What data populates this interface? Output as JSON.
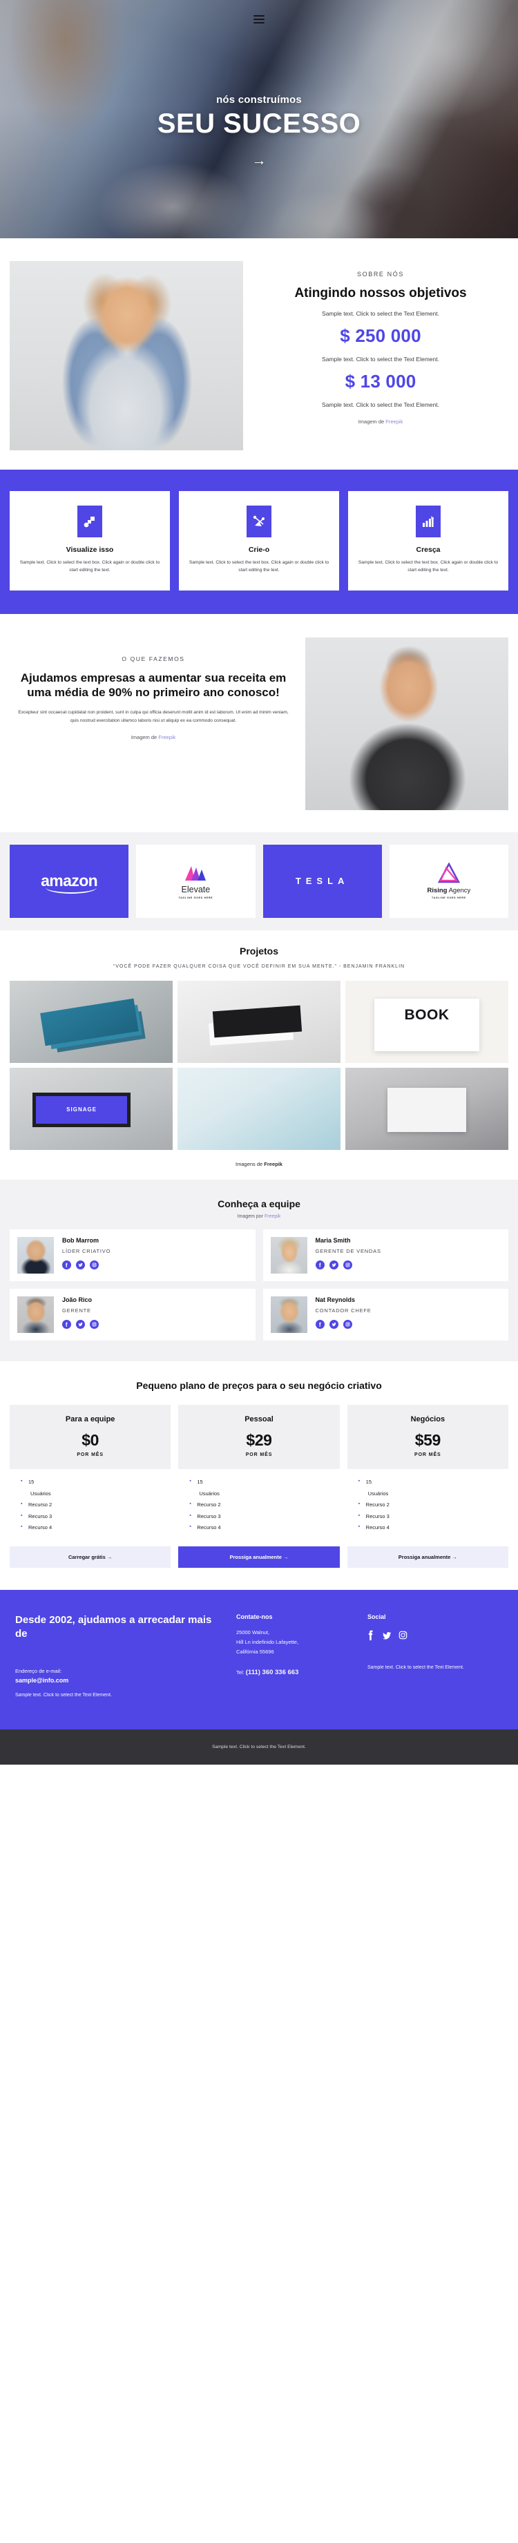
{
  "hero": {
    "menu_icon": "hamburger-menu-icon",
    "eyebrow": "nós construímos",
    "title": "SEU SUCESSO",
    "arrow": "→"
  },
  "about": {
    "eyebrow": "SOBRE NÓS",
    "title": "Atingindo nossos objetivos",
    "desc1": "Sample text. Click to select the Text Element.",
    "stat1": "$ 250 000",
    "desc2": "Sample text. Click to select the Text Element.",
    "stat2": "$ 13 000",
    "desc3": "Sample text. Click to select the Text Element.",
    "credit_prefix": "Imagem de ",
    "credit_link": "Freepik"
  },
  "features": {
    "cards": [
      {
        "icon": "shapes-icon",
        "title": "Visualize isso",
        "body": "Sample text. Click to select the text box. Click again or double click to start editing the text."
      },
      {
        "icon": "node-network-icon",
        "title": "Crie-o",
        "body": "Sample text. Click to select the text box. Click again or double click to start editing the text."
      },
      {
        "icon": "bar-chart-growth-icon",
        "title": "Cresça",
        "body": "Sample text. Click to select the text box. Click again or double click to start editing the text."
      }
    ]
  },
  "whatwedo": {
    "eyebrow": "O QUE FAZEMOS",
    "title": "Ajudamos empresas a aumentar sua receita em uma média de 90% no primeiro ano conosco!",
    "body": "Excepteur sint occaecat cupidatat non proident, sunt in culpa qui officia deserunt mollit anim id est laborum. Ut enim ad minim veniam, quis nostrud exercitation ullamco laboris nisi ut aliquip ex ea commodo consequat.",
    "credit_prefix": "Imagem de ",
    "credit_link": "Freepik"
  },
  "logos": [
    {
      "name": "amazon",
      "tagline": ""
    },
    {
      "name": "Elevate",
      "tagline": "TAGLINE GOES HERE"
    },
    {
      "name": "TESLA",
      "tagline": ""
    },
    {
      "name_bold": "Rising",
      "name_rest": " Agency",
      "tagline": "TAGLINE GOES HERE"
    }
  ],
  "projects": {
    "title": "Projetos",
    "quote": "“VOCÊ PODE FAZER QUALQUER COISA QUE VOCÊ DEFINIR EM SUA MENTE.” - BENJAMIN FRANKLIN",
    "credit_prefix": "Imagens de ",
    "credit_link": "Freepik"
  },
  "team": {
    "title": "Conheça a equipe",
    "credit_prefix": "Imagem por ",
    "credit_link": "Freepik",
    "members": [
      {
        "name": "Bob Marrom",
        "role": "LÍDER CRIATIVO"
      },
      {
        "name": "Maria Smith",
        "role": "GERENTE DE VENDAS"
      },
      {
        "name": "João Rico",
        "role": "GERENTE"
      },
      {
        "name": "Nat Reynolds",
        "role": "CONTADOR CHEFE"
      }
    ],
    "social_icons": [
      "facebook-icon",
      "twitter-icon",
      "instagram-icon"
    ]
  },
  "pricing": {
    "title": "Pequeno plano de preços para o seu negócio criativo",
    "plans": [
      {
        "name": "Para a equipe",
        "amount": "$0",
        "per": "POR MÊS",
        "features": [
          "15",
          "Usuários",
          "Recurso 2",
          "Recurso 3",
          "Recurso 4"
        ],
        "cta": "Carregar grátis →",
        "cta_style": "light"
      },
      {
        "name": "Pessoal",
        "amount": "$29",
        "per": "POR MÊS",
        "features": [
          "15",
          "Usuários",
          "Recurso 2",
          "Recurso 3",
          "Recurso 4"
        ],
        "cta": "Prossiga anualmente →",
        "cta_style": "primary"
      },
      {
        "name": "Negócios",
        "amount": "$59",
        "per": "POR MÊS",
        "features": [
          "15",
          "Usuários",
          "Recurso 2",
          "Recurso 3",
          "Recurso 4"
        ],
        "cta": "Prossiga anualmente →",
        "cta_style": "light"
      }
    ]
  },
  "footer": {
    "headline": "Desde 2002, ajudamos a arrecadar mais de",
    "email_label": "Endereço de e-mail:",
    "email": "sample@info.com",
    "left_note": "Sample text. Click to select the Text Element.",
    "contact_title": "Contate-nos",
    "address_line1": "25000 Walnut,",
    "address_line2": "Hill Ln indefinido Lafayette,",
    "address_line3": "Califórnia 55696",
    "tel_label": "Tel:",
    "tel_value": "(111) 360 336 663",
    "social_title": "Social",
    "social_icons": [
      "facebook-icon",
      "twitter-icon",
      "instagram-icon"
    ],
    "right_note": "Sample text. Click to select the Text Element.",
    "copyright": "Sample text. Click to select the Text Element."
  },
  "colors": {
    "accent": "#4f46e5",
    "light_accent": "#eeeefb",
    "surface": "#f2f2f4",
    "dark": "#343438"
  }
}
